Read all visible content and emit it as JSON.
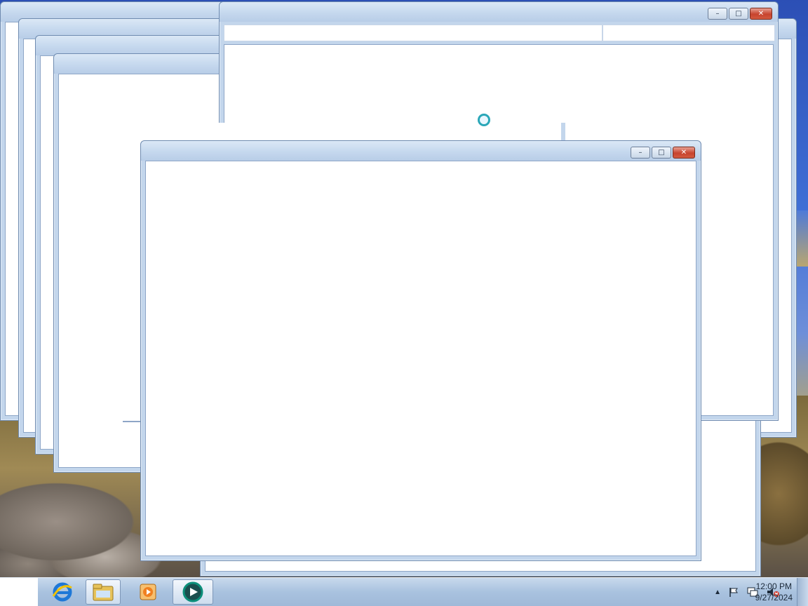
{
  "desktop": {
    "windows_count": 7
  },
  "taskbar": {
    "pinned": [
      {
        "name": "internet-explorer",
        "icon": "ie-icon"
      },
      {
        "name": "file-explorer",
        "icon": "folder-icon"
      },
      {
        "name": "media-player",
        "icon": "media-player-icon"
      },
      {
        "name": "active-app",
        "icon": "app-play-icon"
      }
    ],
    "tray": {
      "clock_time": "12:00 PM",
      "clock_date": "9/27/2024"
    }
  },
  "window_controls": {
    "minimize": "–",
    "maximize": "□",
    "close": "✕"
  }
}
